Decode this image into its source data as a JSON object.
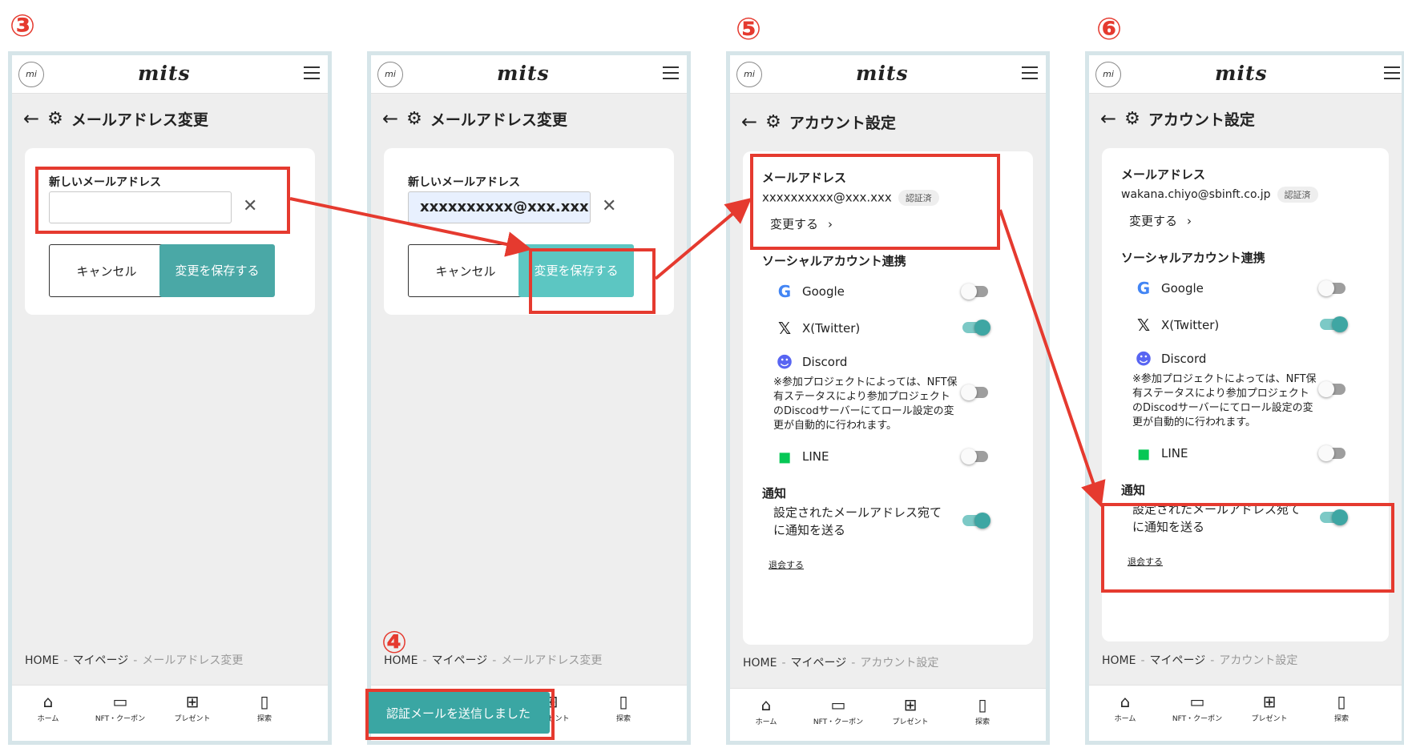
{
  "steps": [
    "③",
    "④",
    "⑤",
    "⑥"
  ],
  "app": {
    "avatar_text": "mi",
    "logo": "mits"
  },
  "screen1": {
    "title": "メールアドレス変更",
    "field_label": "新しいメールアドレス",
    "email_value": "",
    "cancel": "キャンセル",
    "save": "変更を保存する",
    "breadcrumb": [
      "HOME",
      "マイページ",
      "メールアドレス変更"
    ]
  },
  "screen2": {
    "title": "メールアドレス変更",
    "field_label": "新しいメールアドレス",
    "email_value": "xxxxxxxxxx@xxx.xxx",
    "cancel": "キャンセル",
    "save": "変更を保存する",
    "breadcrumb": [
      "HOME",
      "マイページ",
      "メールアドレス変更"
    ],
    "toast": "認証メールを送信しました"
  },
  "screen3": {
    "title": "アカウント設定",
    "email_label": "メールアドレス",
    "email": "xxxxxxxxxx@xxx.xxx",
    "verified": "認証済",
    "change": "変更する",
    "social_title": "ソーシャルアカウント連携",
    "google": "Google",
    "twitter": "X(Twitter)",
    "discord": "Discord",
    "discord_note": "※参加プロジェクトによっては、NFT保有ステータスにより参加プロジェクトのDiscodサーバーにてロール設定の変更が自動的に行われます。",
    "line": "LINE",
    "notify_title": "通知",
    "notify_text": "設定されたメールアドレス宛てに通知を送る",
    "withdraw": "退会する",
    "breadcrumb": [
      "HOME",
      "マイページ",
      "アカウント設定"
    ]
  },
  "screen4": {
    "title": "アカウント設定",
    "email_label": "メールアドレス",
    "email": "wakana.chiyo@sbinft.co.jp",
    "verified": "認証済",
    "change": "変更する",
    "social_title": "ソーシャルアカウント連携",
    "google": "Google",
    "twitter": "X(Twitter)",
    "discord": "Discord",
    "discord_note": "※参加プロジェクトによっては、NFT保有ステータスにより参加プロジェクトのDiscodサーバーにてロール設定の変更が自動的に行われます。",
    "line": "LINE",
    "notify_title": "通知",
    "notify_text": "設定されたメールアドレス宛てに通知を送る",
    "withdraw": "退会する",
    "breadcrumb": [
      "HOME",
      "マイページ",
      "アカウント設定"
    ]
  },
  "nav": {
    "home": "ホーム",
    "coupon": "NFT・クーポン",
    "present": "プレゼント",
    "explore": "探索"
  },
  "toggles": {
    "google": false,
    "twitter": true,
    "discord": false,
    "line": false,
    "notify": true
  },
  "colors": {
    "accent": "#4aa8a6",
    "highlight": "#e53a2f"
  }
}
